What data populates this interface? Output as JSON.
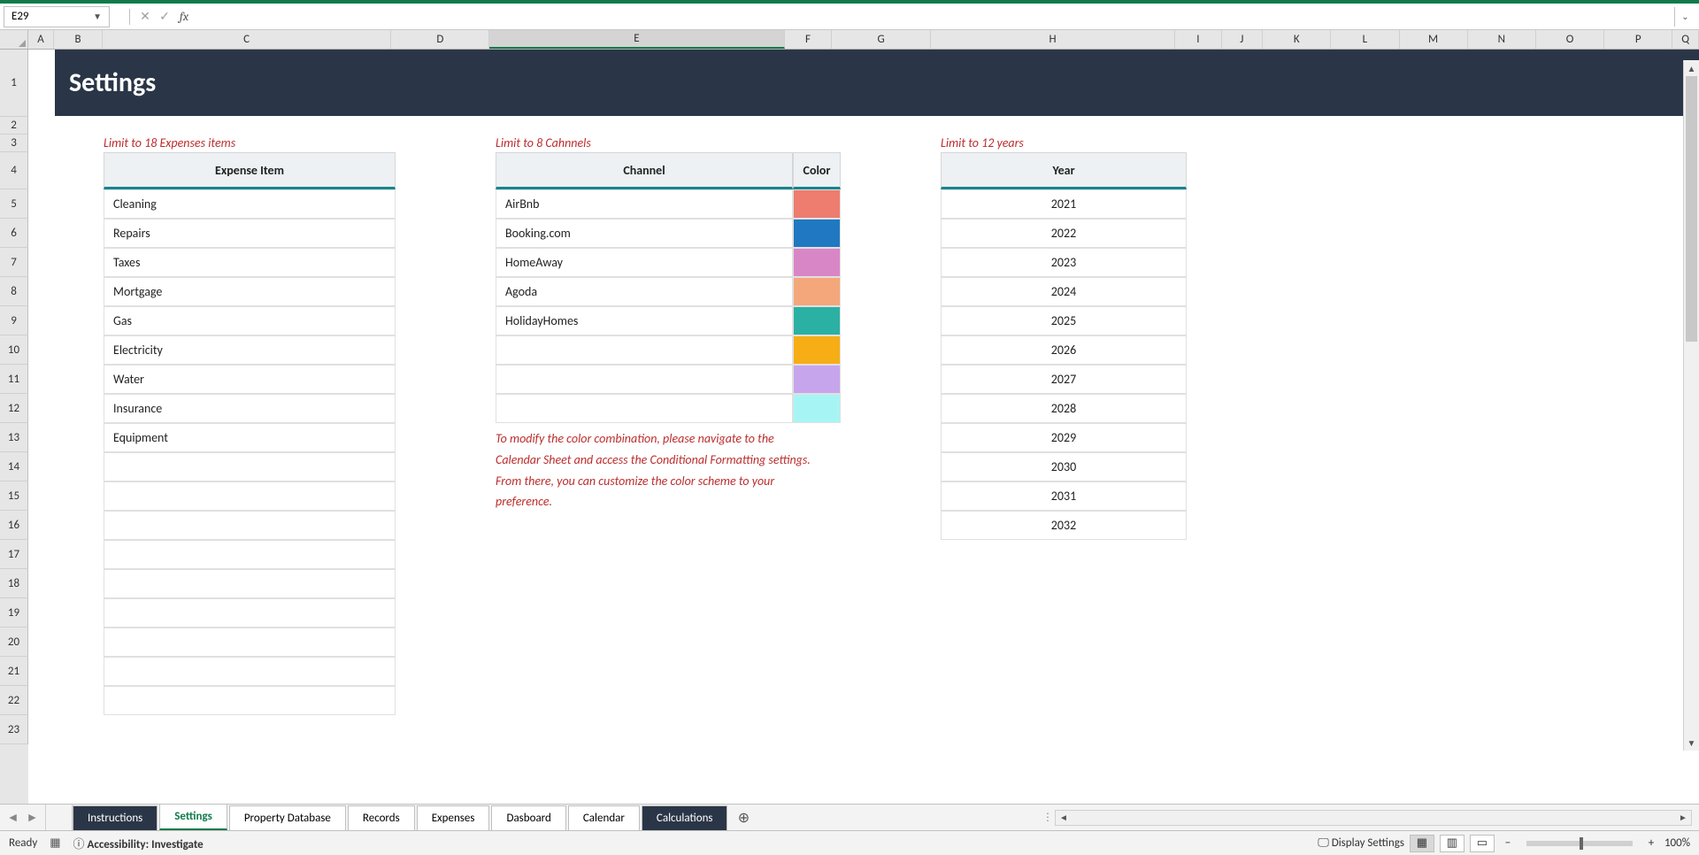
{
  "name_box": "E29",
  "columns": [
    "A",
    "B",
    "C",
    "D",
    "E",
    "F",
    "G",
    "H",
    "I",
    "J",
    "K",
    "L",
    "M",
    "N",
    "O",
    "P",
    "Q"
  ],
  "active_column": "E",
  "rows": [
    1,
    2,
    3,
    4,
    5,
    6,
    7,
    8,
    9,
    10,
    11,
    12,
    13,
    14,
    15,
    16,
    17,
    18,
    19,
    20,
    21,
    22,
    23
  ],
  "page_title": "Settings",
  "captions": {
    "expenses": "Limit to 18 Expenses items",
    "channels": "Limit to 8 Cahnnels",
    "years": "Limit to 12 years"
  },
  "expense_header": "Expense Item",
  "expenses": [
    "Cleaning",
    "Repairs",
    "Taxes",
    "Mortgage",
    "Gas",
    "Electricity",
    "Water",
    "Insurance",
    "Equipment",
    "",
    "",
    "",
    "",
    "",
    "",
    "",
    "",
    ""
  ],
  "channel_header": "Channel",
  "color_header": "Color",
  "channels": [
    {
      "name": "AirBnb",
      "color": "#ee7c6f"
    },
    {
      "name": "Booking.com",
      "color": "#1f78c1"
    },
    {
      "name": "HomeAway",
      "color": "#d986c7"
    },
    {
      "name": "Agoda",
      "color": "#f4a77a"
    },
    {
      "name": "HolidayHomes",
      "color": "#2bb0a4"
    },
    {
      "name": "",
      "color": "#f7ae14"
    },
    {
      "name": "",
      "color": "#c7a5ec"
    },
    {
      "name": "",
      "color": "#a6f5f4"
    }
  ],
  "channel_note": "To modify the color combination, please navigate to the Calendar Sheet and access the Conditional Formatting settings. From there, you can customize the color scheme to your preference.",
  "year_header": "Year",
  "years": [
    "2021",
    "2022",
    "2023",
    "2024",
    "2025",
    "2026",
    "2027",
    "2028",
    "2029",
    "2030",
    "2031",
    "2032"
  ],
  "tabs": [
    {
      "label": "Instructions",
      "style": "dark"
    },
    {
      "label": "Settings",
      "style": "active"
    },
    {
      "label": "Property Database",
      "style": "normal"
    },
    {
      "label": "Records",
      "style": "normal"
    },
    {
      "label": "Expenses",
      "style": "normal"
    },
    {
      "label": "Dasboard",
      "style": "normal"
    },
    {
      "label": "Calendar",
      "style": "normal"
    },
    {
      "label": "Calculations",
      "style": "dark"
    }
  ],
  "status": {
    "ready": "Ready",
    "accessibility": "Accessibility: Investigate",
    "display_settings": "Display Settings",
    "zoom": "100%"
  }
}
